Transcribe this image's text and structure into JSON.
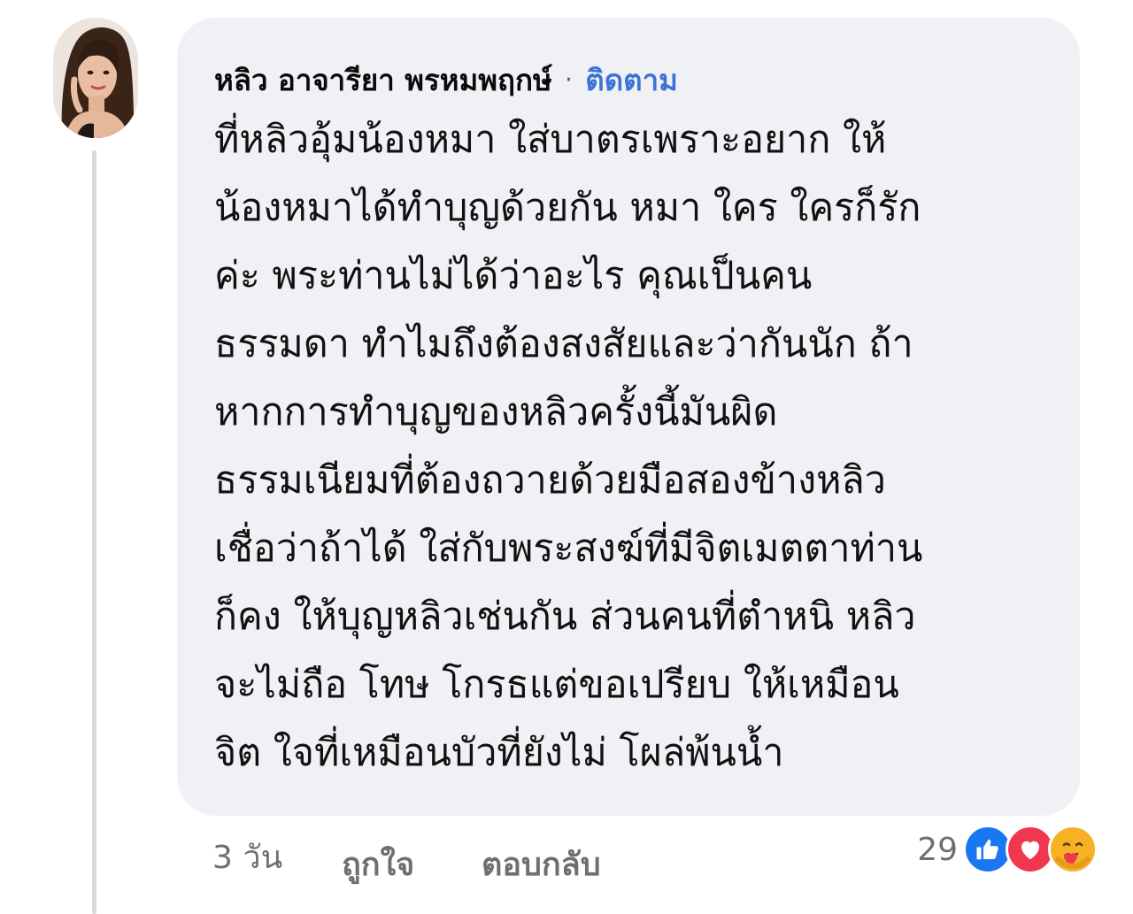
{
  "comment": {
    "author": "หลิว อาจารียา พรหมพฤกษ์",
    "separator": "·",
    "follow_label": "ติดตาม",
    "lines": [
      "ที่หลิวอุ้มน้องหมา ใส่บาตรเพราะอยาก ให้",
      "น้องหมาได้ทำบุญด้วยกัน หมา ใคร ใครก็รัก",
      "ค่ะ  พระท่านไม่ได้ว่าอะไร คุณเป็นคน",
      "ธรรมดา ทำไมถึงต้องสงสัยและว่ากันนัก ถ้า",
      "หากการทำบุญของหลิวครั้งนี้มันผิด",
      "ธรรมเนียมที่ต้องถวายด้วยมือสองข้างหลิว",
      "เชื่อว่าถ้าได้ ใส่กับพระสงฆ์ที่มีจิตเมตตาท่าน",
      "ก็คง ให้บุญหลิวเช่นกัน ส่วนคนที่ตำหนิ หลิว",
      "จะไม่ถือ โทษ โกรธแต่ขอเปรียบ ให้เหมือน",
      "จิต ใจที่เหมือนบัวที่ยังไม่ โผล่พ้นน้ำ"
    ]
  },
  "footer": {
    "timestamp": "3 วัน",
    "like_label": "ถูกใจ",
    "reply_label": "ตอบกลับ",
    "reaction_count": "29",
    "reactions": [
      "like-icon",
      "love-icon",
      "care-icon"
    ]
  },
  "colors": {
    "bubble": "#eff1f4",
    "link": "#3b73d6",
    "muted": "#6d6f74",
    "like": "#1a77f2",
    "love": "#f0374f",
    "care": "#f7b125"
  }
}
